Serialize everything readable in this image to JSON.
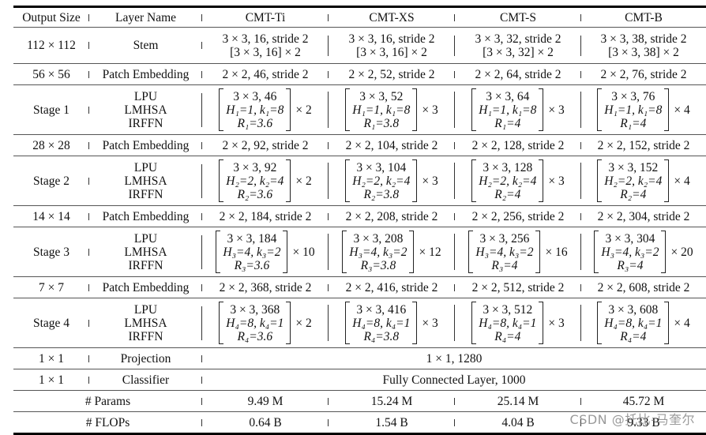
{
  "table": {
    "headers": [
      "Output Size",
      "Layer Name",
      "CMT-Ti",
      "CMT-XS",
      "CMT-S",
      "CMT-B"
    ],
    "stem": {
      "output_size": "112 × 112",
      "layer": "Stem",
      "cols": [
        {
          "line1": "3 × 3, 16, stride 2",
          "line2": "[3 × 3, 16] × 2"
        },
        {
          "line1": "3 × 3, 16, stride 2",
          "line2": "[3 × 3, 16] × 2"
        },
        {
          "line1": "3 × 3, 32, stride 2",
          "line2": "[3 × 3, 32] × 2"
        },
        {
          "line1": "3 × 3, 38, stride 2",
          "line2": "[3 × 3, 38] × 2"
        }
      ]
    },
    "patch_embeddings": [
      {
        "output_size": "56 × 56",
        "layer": "Patch Embedding",
        "cols": [
          "2 × 2, 46, stride 2",
          "2 × 2, 52, stride 2",
          "2 × 2, 64, stride 2",
          "2 × 2, 76, stride 2"
        ]
      },
      {
        "output_size": "28 × 28",
        "layer": "Patch Embedding",
        "cols": [
          "2 × 2, 92, stride 2",
          "2 × 2, 104, stride 2",
          "2 × 2, 128, stride 2",
          "2 × 2, 152, stride 2"
        ]
      },
      {
        "output_size": "14 × 14",
        "layer": "Patch Embedding",
        "cols": [
          "2 × 2, 184, stride 2",
          "2 × 2, 208, stride 2",
          "2 × 2, 256, stride 2",
          "2 × 2, 304, stride 2"
        ]
      },
      {
        "output_size": "7 × 7",
        "layer": "Patch Embedding",
        "cols": [
          "2 × 2, 368, stride 2",
          "2 × 2, 416, stride 2",
          "2 × 2, 512, stride 2",
          "2 × 2, 608, stride 2"
        ]
      }
    ],
    "stages": [
      {
        "name": "Stage 1",
        "layers": [
          "LPU",
          "LMHSA",
          "IRFFN"
        ],
        "cols": [
          {
            "conv": "3 × 3, 46",
            "attn": "H₁=1, k₁=8",
            "ratio": "R₁=3.6",
            "repeat": "× 2"
          },
          {
            "conv": "3 × 3, 52",
            "attn": "H₁=1, k₁=8",
            "ratio": "R₁=3.8",
            "repeat": "× 3"
          },
          {
            "conv": "3 × 3, 64",
            "attn": "H₁=1, k₁=8",
            "ratio": "R₁=4",
            "repeat": "× 3"
          },
          {
            "conv": "3 × 3, 76",
            "attn": "H₁=1, k₁=8",
            "ratio": "R₁=4",
            "repeat": "× 4"
          }
        ]
      },
      {
        "name": "Stage 2",
        "layers": [
          "LPU",
          "LMHSA",
          "IRFFN"
        ],
        "cols": [
          {
            "conv": "3 × 3, 92",
            "attn": "H₂=2, k₂=4",
            "ratio": "R₂=3.6",
            "repeat": "× 2"
          },
          {
            "conv": "3 × 3, 104",
            "attn": "H₂=2, k₂=4",
            "ratio": "R₂=3.8",
            "repeat": "× 3"
          },
          {
            "conv": "3 × 3, 128",
            "attn": "H₂=2, k₂=4",
            "ratio": "R₂=4",
            "repeat": "× 3"
          },
          {
            "conv": "3 × 3, 152",
            "attn": "H₂=2, k₂=4",
            "ratio": "R₂=4",
            "repeat": "× 4"
          }
        ]
      },
      {
        "name": "Stage 3",
        "layers": [
          "LPU",
          "LMHSA",
          "IRFFN"
        ],
        "cols": [
          {
            "conv": "3 × 3, 184",
            "attn": "H₃=4, k₃=2",
            "ratio": "R₃=3.6",
            "repeat": "× 10"
          },
          {
            "conv": "3 × 3, 208",
            "attn": "H₃=4, k₃=2",
            "ratio": "R₃=3.8",
            "repeat": "× 12"
          },
          {
            "conv": "3 × 3, 256",
            "attn": "H₃=4, k₃=2",
            "ratio": "R₃=4",
            "repeat": "× 16"
          },
          {
            "conv": "3 × 3, 304",
            "attn": "H₃=4, k₃=2",
            "ratio": "R₃=4",
            "repeat": "× 20"
          }
        ]
      },
      {
        "name": "Stage 4",
        "layers": [
          "LPU",
          "LMHSA",
          "IRFFN"
        ],
        "cols": [
          {
            "conv": "3 × 3, 368",
            "attn": "H₄=8, k₄=1",
            "ratio": "R₄=3.6",
            "repeat": "× 2"
          },
          {
            "conv": "3 × 3, 416",
            "attn": "H₄=8, k₄=1",
            "ratio": "R₄=3.8",
            "repeat": "× 3"
          },
          {
            "conv": "3 × 3, 512",
            "attn": "H₄=8, k₄=1",
            "ratio": "R₄=4",
            "repeat": "× 3"
          },
          {
            "conv": "3 × 3, 608",
            "attn": "H₄=8, k₄=1",
            "ratio": "R₄=4",
            "repeat": "× 4"
          }
        ]
      }
    ],
    "projection": {
      "output_size": "1 × 1",
      "layer": "Projection",
      "value": "1 × 1, 1280"
    },
    "classifier": {
      "output_size": "1 × 1",
      "layer": "Classifier",
      "value": "Fully Connected Layer, 1000"
    },
    "params": {
      "label": "# Params",
      "cols": [
        "9.49 M",
        "15.24 M",
        "25.14 M",
        "45.72 M"
      ]
    },
    "flops": {
      "label": "# FLOPs",
      "cols": [
        "0.64 B",
        "1.54 B",
        "4.04 B",
        "9.33 B"
      ]
    }
  },
  "watermark": "CSDN @托比-马奎尔"
}
